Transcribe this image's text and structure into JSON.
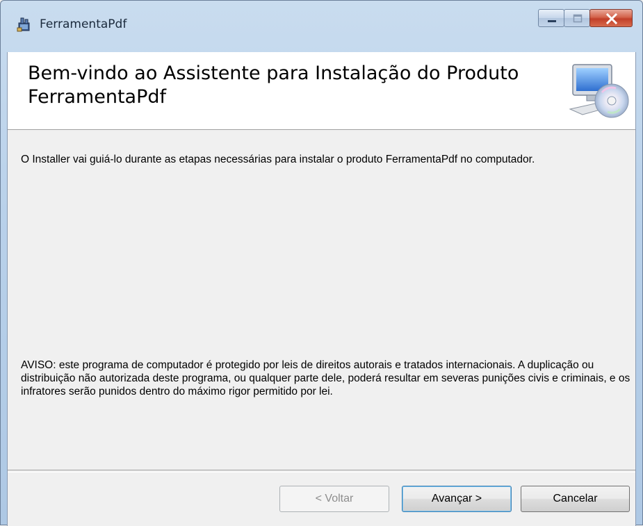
{
  "window": {
    "title": "FerramentaPdf"
  },
  "banner": {
    "title": "Bem-vindo ao Assistente para Instalação do Produto FerramentaPdf",
    "icon": "computer-disc-icon"
  },
  "body": {
    "intro": "O Installer vai guiá-lo durante as etapas necessárias para instalar o produto FerramentaPdf no computador.",
    "warning": "AVISO: este programa de computador é protegido por leis de direitos autorais e tratados internacionais. A duplicação ou distribuição não autorizada deste programa, ou qualquer parte dele, poderá resultar em severas punições civis e criminais, e os infratores serão punidos dentro do máximo rigor permitido por lei."
  },
  "buttons": {
    "back": "< Voltar",
    "next": "Avançar >",
    "cancel": "Cancelar"
  },
  "colors": {
    "titlebar": "#b9d1ea",
    "close_button": "#c2402a",
    "banner_bg": "#ffffff",
    "client_bg": "#f0f0f0"
  }
}
